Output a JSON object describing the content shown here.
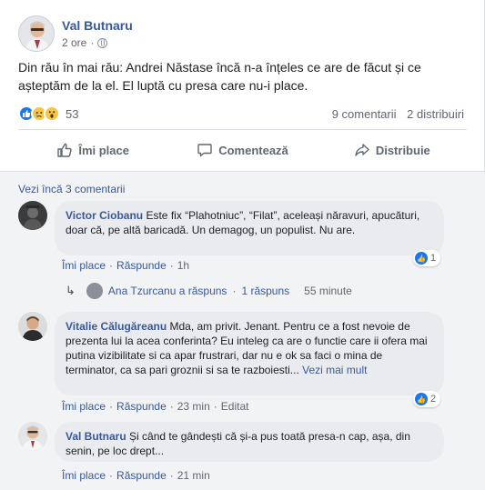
{
  "post": {
    "author": "Val Butnaru",
    "time": "2 ore",
    "privacy_icon": "globe-icon",
    "text": "Din rău în mai rău: Andrei Năstase încă n-a înțeles ce are de făcut și ce așteptăm de la el. El luptă cu presa care nu-i place.",
    "reaction_count": "53",
    "comment_count": "9 comentarii",
    "share_count": "2 distribuiri"
  },
  "actions": {
    "like": "Îmi place",
    "comment": "Comentează",
    "share": "Distribuie"
  },
  "comments_section": {
    "view_more": "Vezi încă 3 comentarii"
  },
  "comments": [
    {
      "name": "Victor Ciobanu",
      "text": "Este fix “Plahotniuc”, “Filat”, aceleași năravuri, apucături, doar că, pe altă baricadă. Un demagog, un populist. Nu are.",
      "like": "Îmi place",
      "reply": "Răspunde",
      "time": "1h",
      "likes": "1"
    },
    {
      "name": "Vitalie Călugăreanu",
      "text": "Mda, am privit. Jenant. Pentru ce a fost nevoie de prezenta lui la acea conferinta? Eu inteleg ca are o functie care ii ofera mai putina vizibilitate si ca apar frustrari, dar nu e ok sa faci o mina de terminator, ca sa pari groznii si sa te razboiesti...",
      "see_more": "Vezi mai mult",
      "like": "Îmi place",
      "reply": "Răspunde",
      "time": "23 min",
      "edited": "Editat",
      "likes": "2"
    },
    {
      "name": "Val Butnaru",
      "text": "Și când te gândești că și-a pus toată presa-n cap, așa, din senin, pe loc drept...",
      "like": "Îmi place",
      "reply": "Răspunde",
      "time": "21 min"
    }
  ],
  "reply_summary": {
    "replier": "Ana Tzurcanu a răspuns",
    "count": "1 răspuns",
    "time": "55 minute"
  }
}
